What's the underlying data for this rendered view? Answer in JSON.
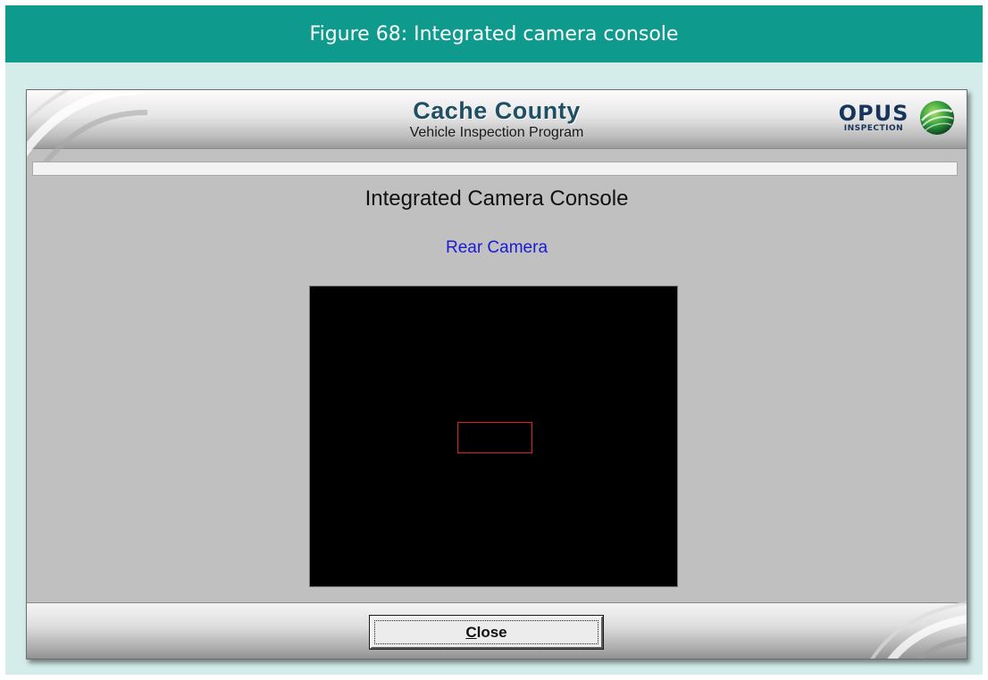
{
  "figure": {
    "caption": "Figure 68: Integrated camera console"
  },
  "app": {
    "banner": {
      "title": "Cache County",
      "subtitle": "Vehicle Inspection Program",
      "logo": {
        "word": "OPUS",
        "sub": "INSPECTION",
        "icon": "globe-swirl-icon"
      }
    },
    "progress": {
      "value": 0
    },
    "console_title": "Integrated Camera Console",
    "camera_label": "Rear Camera",
    "camera_feed": {
      "background": "#000000",
      "target_color": "#e02020"
    },
    "footer": {
      "close_mnemonic": "C",
      "close_rest": "lose"
    }
  },
  "colors": {
    "header_teal": "#0f9a8e",
    "figure_bg": "#d4ecea",
    "window_gray": "#c0c0c0",
    "camera_label_blue": "#1a1ad8",
    "title_navy": "#1f4f63"
  }
}
